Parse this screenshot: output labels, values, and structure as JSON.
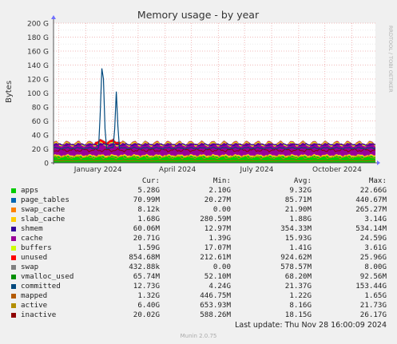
{
  "chart_data": {
    "type": "area",
    "title": "Memory usage - by year",
    "ylabel": "Bytes",
    "side_label": "RRDTOOL / TOBI OETIKER",
    "ylim": [
      0,
      200
    ],
    "y_unit": "G",
    "y_ticks": [
      "0",
      "20 G",
      "40 G",
      "60 G",
      "80 G",
      "100 G",
      "120 G",
      "140 G",
      "160 G",
      "180 G",
      "200 G"
    ],
    "x_ticks": [
      "January 2024",
      "April 2024",
      "July 2024",
      "October 2024"
    ],
    "x_range": [
      "2023-11-25",
      "2024-11-28"
    ],
    "grid": true,
    "columns": [
      "",
      "Cur:",
      "Min:",
      "Avg:",
      "Max:"
    ],
    "series": [
      {
        "name": "apps",
        "color": "#00cc00",
        "cur": "5.28G",
        "min": "2.10G",
        "avg": "9.32G",
        "max": "22.66G",
        "level": 9
      },
      {
        "name": "page_tables",
        "color": "#0066b3",
        "cur": "70.99M",
        "min": "20.27M",
        "avg": "85.71M",
        "max": "440.67M",
        "level": 0.1
      },
      {
        "name": "swap_cache",
        "color": "#ff8000",
        "cur": "8.12k",
        "min": "0.00",
        "avg": "21.90M",
        "max": "265.27M",
        "level": 0.05
      },
      {
        "name": "slab_cache",
        "color": "#ffcc00",
        "cur": "1.68G",
        "min": "280.59M",
        "avg": "1.88G",
        "max": "3.14G",
        "level": 1.9
      },
      {
        "name": "shmem",
        "color": "#330099",
        "cur": "60.06M",
        "min": "12.97M",
        "avg": "354.33M",
        "max": "534.14M",
        "level": 0.4
      },
      {
        "name": "cache",
        "color": "#990099",
        "cur": "20.71G",
        "min": "1.39G",
        "avg": "15.93G",
        "max": "24.59G",
        "level": 15
      },
      {
        "name": "buffers",
        "color": "#ccff00",
        "cur": "1.59G",
        "min": "17.07M",
        "avg": "1.41G",
        "max": "3.61G",
        "level": 1.4
      },
      {
        "name": "unused",
        "color": "#ff0000",
        "cur": "854.68M",
        "min": "212.61M",
        "avg": "924.62M",
        "max": "25.96G",
        "level": 0.9
      },
      {
        "name": "swap",
        "color": "#808080",
        "cur": "432.88k",
        "min": "0.00",
        "avg": "578.57M",
        "max": "8.00G",
        "level": 0.6
      },
      {
        "name": "vmalloc_used",
        "color": "#008f00",
        "cur": "65.74M",
        "min": "52.10M",
        "avg": "68.20M",
        "max": "92.56M",
        "level": 0.07
      },
      {
        "name": "committed",
        "color": "#00487d",
        "cur": "12.73G",
        "min": "4.24G",
        "avg": "21.37G",
        "max": "153.44G",
        "level": 21
      },
      {
        "name": "mapped",
        "color": "#b35a00",
        "cur": "1.32G",
        "min": "446.75M",
        "avg": "1.22G",
        "max": "1.65G",
        "level": 1.2
      },
      {
        "name": "active",
        "color": "#b38f00",
        "cur": "6.40G",
        "min": "653.93M",
        "avg": "8.16G",
        "max": "21.73G",
        "level": 8
      },
      {
        "name": "inactive",
        "color": "#8f0000",
        "cur": "20.02G",
        "min": "588.26M",
        "avg": "18.15G",
        "max": "26.17G",
        "level": 18
      }
    ],
    "committed_spikes": [
      {
        "date": "2024-01-20",
        "value": 142
      },
      {
        "date": "2024-02-05",
        "value": 102
      }
    ]
  },
  "footer": {
    "last_update": "Last update: Thu Nov 28 16:00:09 2024",
    "munin_version": "Munin 2.0.75"
  }
}
